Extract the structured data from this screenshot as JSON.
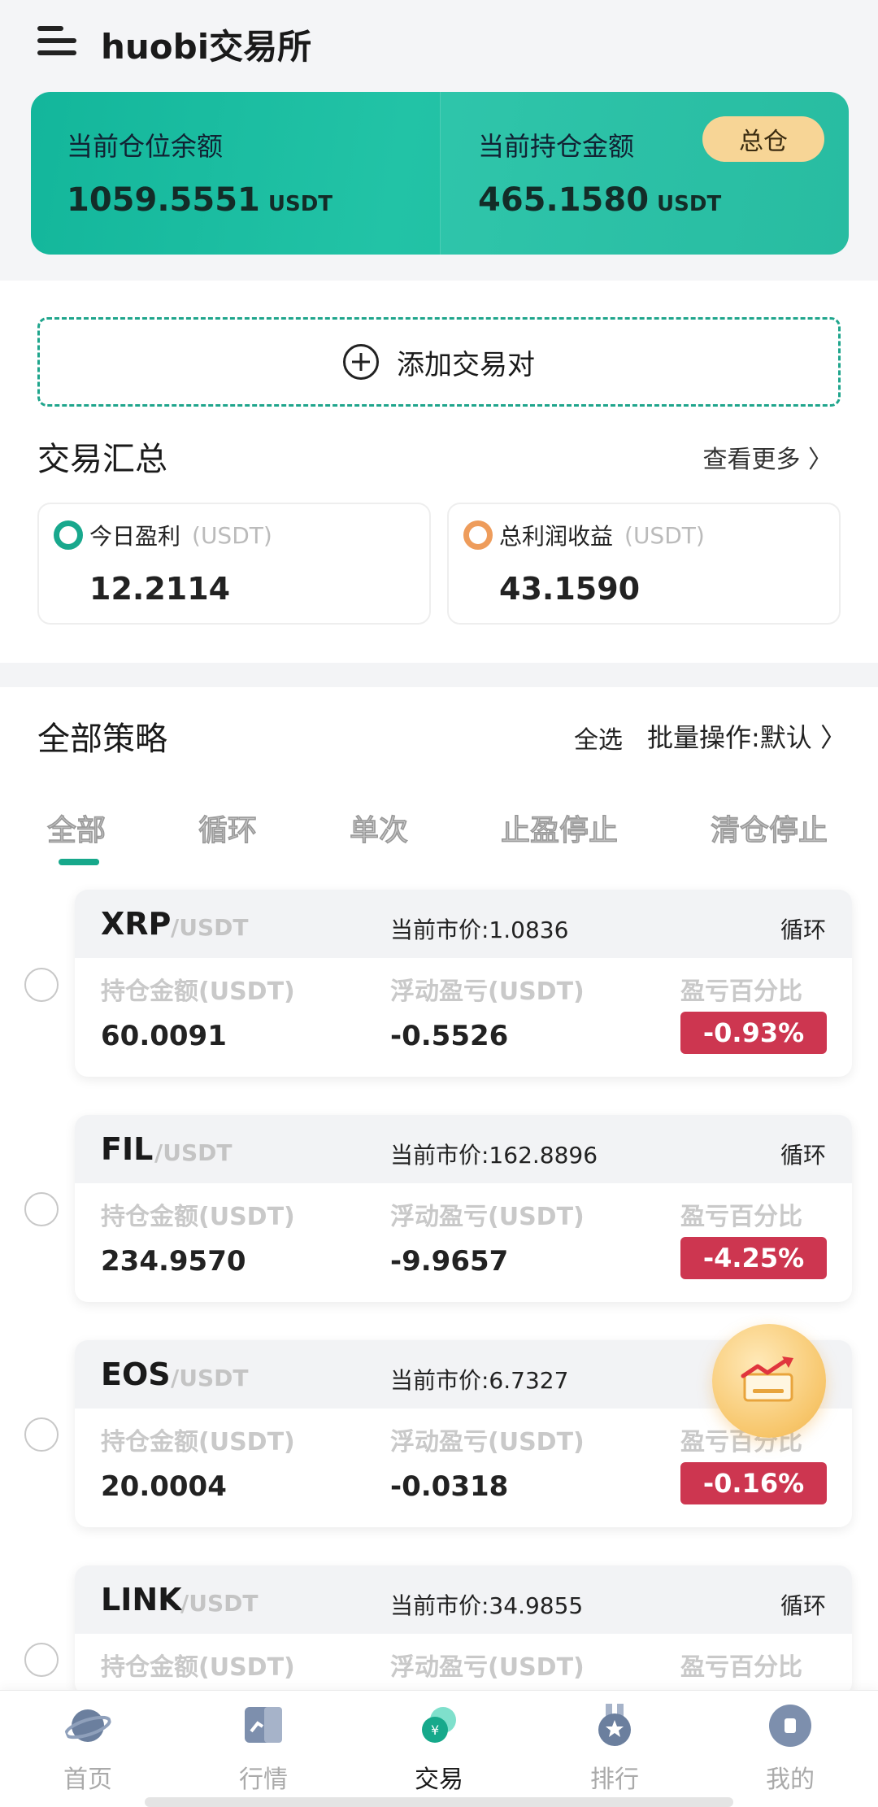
{
  "header": {
    "title": "huobi交易所"
  },
  "balance": {
    "left_label": "当前仓位余额",
    "left_value": "1059.5551",
    "left_unit": "USDT",
    "right_label": "当前持仓金额",
    "right_value": "465.1580",
    "right_unit": "USDT",
    "badge": "总仓"
  },
  "add_pair": {
    "label": "添加交易对"
  },
  "summary": {
    "title": "交易汇总",
    "see_more": "查看更多 〉",
    "today": {
      "label": "今日盈利",
      "unit": "(USDT)",
      "value": "12.2114"
    },
    "total": {
      "label": "总利润收益",
      "unit": "(USDT)",
      "value": "43.1590"
    }
  },
  "strategies": {
    "title": "全部策略",
    "select_all": "全选",
    "batch": "批量操作:默认 〉",
    "tabs": [
      "全部",
      "循环",
      "单次",
      "止盈停止",
      "清仓停止"
    ],
    "col_labels": [
      "持仓金额(USDT)",
      "浮动盈亏(USDT)",
      "盈亏百分比"
    ],
    "items": [
      {
        "symbol": "XRP",
        "quote": "/USDT",
        "price": "当前市价:1.0836",
        "mode": "循环",
        "amount": "60.0091",
        "pnl": "-0.5526",
        "pct": "-0.93%"
      },
      {
        "symbol": "FIL",
        "quote": "/USDT",
        "price": "当前市价:162.8896",
        "mode": "循环",
        "amount": "234.9570",
        "pnl": "-9.9657",
        "pct": "-4.25%"
      },
      {
        "symbol": "EOS",
        "quote": "/USDT",
        "price": "当前市价:6.7327",
        "mode": "环",
        "amount": "20.0004",
        "pnl": "-0.0318",
        "pct": "-0.16%"
      },
      {
        "symbol": "LINK",
        "quote": "/USDT",
        "price": "当前市价:34.9855",
        "mode": "循环",
        "amount": "",
        "pnl": "",
        "pct": ""
      }
    ]
  },
  "bottom_nav": [
    {
      "label": "首页",
      "icon": "planet-icon"
    },
    {
      "label": "行情",
      "icon": "chart-book-icon"
    },
    {
      "label": "交易",
      "icon": "trade-icon"
    },
    {
      "label": "排行",
      "icon": "medal-icon"
    },
    {
      "label": "我的",
      "icon": "profile-icon"
    }
  ],
  "colors": {
    "accent": "#17a88b",
    "loss": "#cd3650",
    "badge": "#f7d596"
  }
}
